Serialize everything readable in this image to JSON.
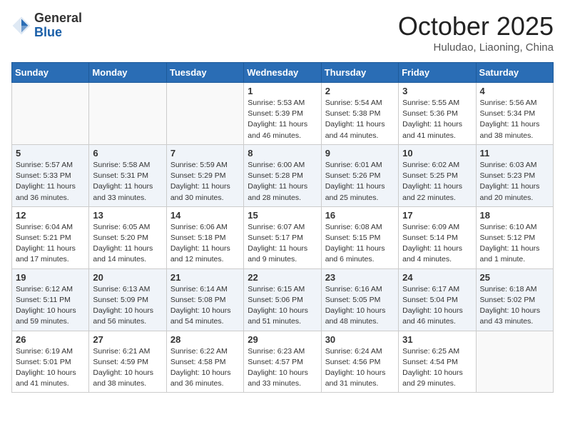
{
  "header": {
    "logo_general": "General",
    "logo_blue": "Blue",
    "month": "October 2025",
    "location": "Huludao, Liaoning, China"
  },
  "days_of_week": [
    "Sunday",
    "Monday",
    "Tuesday",
    "Wednesday",
    "Thursday",
    "Friday",
    "Saturday"
  ],
  "weeks": [
    [
      {
        "day": "",
        "info": ""
      },
      {
        "day": "",
        "info": ""
      },
      {
        "day": "",
        "info": ""
      },
      {
        "day": "1",
        "info": "Sunrise: 5:53 AM\nSunset: 5:39 PM\nDaylight: 11 hours\nand 46 minutes."
      },
      {
        "day": "2",
        "info": "Sunrise: 5:54 AM\nSunset: 5:38 PM\nDaylight: 11 hours\nand 44 minutes."
      },
      {
        "day": "3",
        "info": "Sunrise: 5:55 AM\nSunset: 5:36 PM\nDaylight: 11 hours\nand 41 minutes."
      },
      {
        "day": "4",
        "info": "Sunrise: 5:56 AM\nSunset: 5:34 PM\nDaylight: 11 hours\nand 38 minutes."
      }
    ],
    [
      {
        "day": "5",
        "info": "Sunrise: 5:57 AM\nSunset: 5:33 PM\nDaylight: 11 hours\nand 36 minutes."
      },
      {
        "day": "6",
        "info": "Sunrise: 5:58 AM\nSunset: 5:31 PM\nDaylight: 11 hours\nand 33 minutes."
      },
      {
        "day": "7",
        "info": "Sunrise: 5:59 AM\nSunset: 5:29 PM\nDaylight: 11 hours\nand 30 minutes."
      },
      {
        "day": "8",
        "info": "Sunrise: 6:00 AM\nSunset: 5:28 PM\nDaylight: 11 hours\nand 28 minutes."
      },
      {
        "day": "9",
        "info": "Sunrise: 6:01 AM\nSunset: 5:26 PM\nDaylight: 11 hours\nand 25 minutes."
      },
      {
        "day": "10",
        "info": "Sunrise: 6:02 AM\nSunset: 5:25 PM\nDaylight: 11 hours\nand 22 minutes."
      },
      {
        "day": "11",
        "info": "Sunrise: 6:03 AM\nSunset: 5:23 PM\nDaylight: 11 hours\nand 20 minutes."
      }
    ],
    [
      {
        "day": "12",
        "info": "Sunrise: 6:04 AM\nSunset: 5:21 PM\nDaylight: 11 hours\nand 17 minutes."
      },
      {
        "day": "13",
        "info": "Sunrise: 6:05 AM\nSunset: 5:20 PM\nDaylight: 11 hours\nand 14 minutes."
      },
      {
        "day": "14",
        "info": "Sunrise: 6:06 AM\nSunset: 5:18 PM\nDaylight: 11 hours\nand 12 minutes."
      },
      {
        "day": "15",
        "info": "Sunrise: 6:07 AM\nSunset: 5:17 PM\nDaylight: 11 hours\nand 9 minutes."
      },
      {
        "day": "16",
        "info": "Sunrise: 6:08 AM\nSunset: 5:15 PM\nDaylight: 11 hours\nand 6 minutes."
      },
      {
        "day": "17",
        "info": "Sunrise: 6:09 AM\nSunset: 5:14 PM\nDaylight: 11 hours\nand 4 minutes."
      },
      {
        "day": "18",
        "info": "Sunrise: 6:10 AM\nSunset: 5:12 PM\nDaylight: 11 hours\nand 1 minute."
      }
    ],
    [
      {
        "day": "19",
        "info": "Sunrise: 6:12 AM\nSunset: 5:11 PM\nDaylight: 10 hours\nand 59 minutes."
      },
      {
        "day": "20",
        "info": "Sunrise: 6:13 AM\nSunset: 5:09 PM\nDaylight: 10 hours\nand 56 minutes."
      },
      {
        "day": "21",
        "info": "Sunrise: 6:14 AM\nSunset: 5:08 PM\nDaylight: 10 hours\nand 54 minutes."
      },
      {
        "day": "22",
        "info": "Sunrise: 6:15 AM\nSunset: 5:06 PM\nDaylight: 10 hours\nand 51 minutes."
      },
      {
        "day": "23",
        "info": "Sunrise: 6:16 AM\nSunset: 5:05 PM\nDaylight: 10 hours\nand 48 minutes."
      },
      {
        "day": "24",
        "info": "Sunrise: 6:17 AM\nSunset: 5:04 PM\nDaylight: 10 hours\nand 46 minutes."
      },
      {
        "day": "25",
        "info": "Sunrise: 6:18 AM\nSunset: 5:02 PM\nDaylight: 10 hours\nand 43 minutes."
      }
    ],
    [
      {
        "day": "26",
        "info": "Sunrise: 6:19 AM\nSunset: 5:01 PM\nDaylight: 10 hours\nand 41 minutes."
      },
      {
        "day": "27",
        "info": "Sunrise: 6:21 AM\nSunset: 4:59 PM\nDaylight: 10 hours\nand 38 minutes."
      },
      {
        "day": "28",
        "info": "Sunrise: 6:22 AM\nSunset: 4:58 PM\nDaylight: 10 hours\nand 36 minutes."
      },
      {
        "day": "29",
        "info": "Sunrise: 6:23 AM\nSunset: 4:57 PM\nDaylight: 10 hours\nand 33 minutes."
      },
      {
        "day": "30",
        "info": "Sunrise: 6:24 AM\nSunset: 4:56 PM\nDaylight: 10 hours\nand 31 minutes."
      },
      {
        "day": "31",
        "info": "Sunrise: 6:25 AM\nSunset: 4:54 PM\nDaylight: 10 hours\nand 29 minutes."
      },
      {
        "day": "",
        "info": ""
      }
    ]
  ]
}
